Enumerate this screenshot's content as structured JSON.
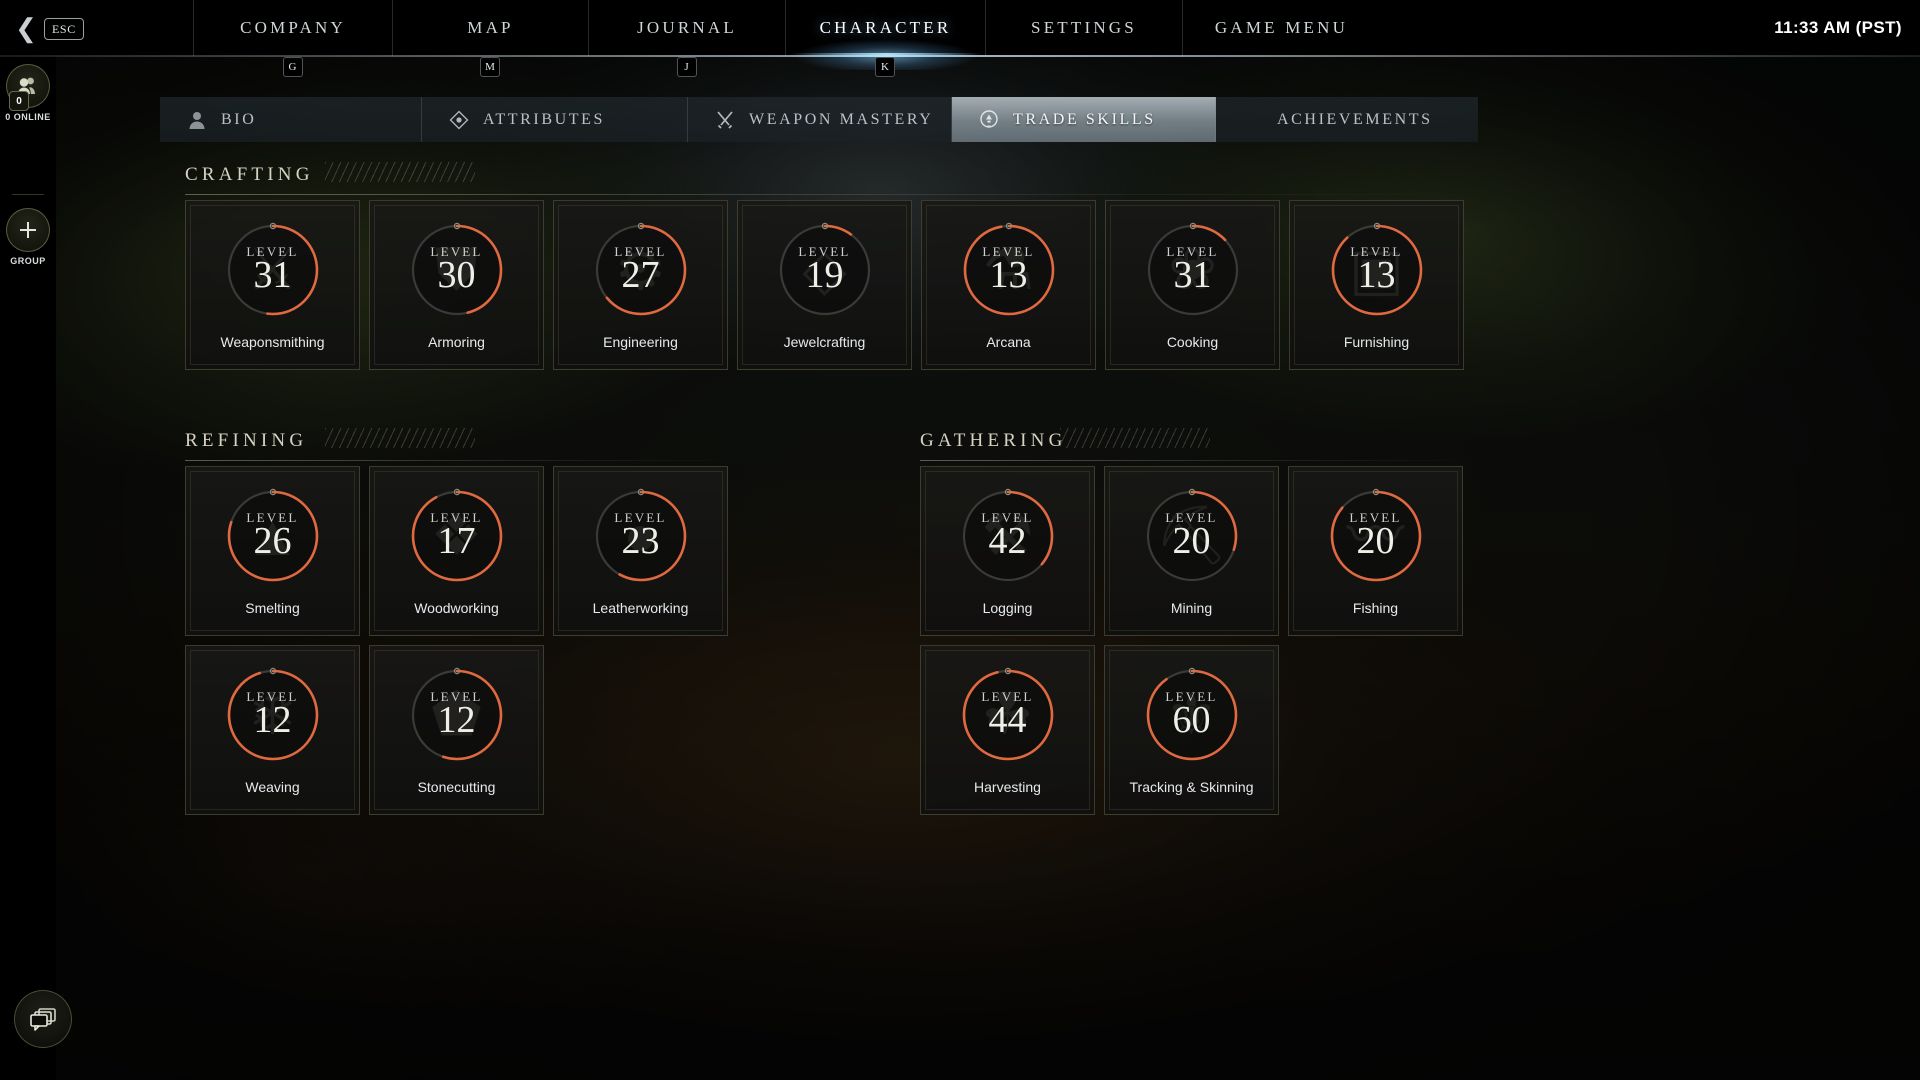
{
  "topbar": {
    "back_icon": "chevron-left-icon",
    "esc_label": "ESC",
    "clock": "11:33 AM  (PST)",
    "items": [
      {
        "label": "COMPANY",
        "key": "G",
        "active": false
      },
      {
        "label": "MAP",
        "key": "M",
        "active": false
      },
      {
        "label": "JOURNAL",
        "key": "J",
        "active": false
      },
      {
        "label": "CHARACTER",
        "key": "K",
        "active": true
      },
      {
        "label": "SETTINGS",
        "key": "",
        "active": false
      },
      {
        "label": "GAME MENU",
        "key": "",
        "active": false
      }
    ]
  },
  "sidebar": {
    "online_count": "0",
    "online_label": "0 ONLINE",
    "group_label": "GROUP",
    "group_icon": "plus-icon",
    "online_icon": "people-icon",
    "chat_icon": "chat-bubbles-icon"
  },
  "tabs": [
    {
      "label": "BIO",
      "icon": "bust-icon",
      "active": false
    },
    {
      "label": "ATTRIBUTES",
      "icon": "diamond-icon",
      "active": false
    },
    {
      "label": "WEAPON MASTERY",
      "icon": "swords-icon",
      "active": false
    },
    {
      "label": "TRADE SKILLS",
      "icon": "anvil-ring-icon",
      "active": true
    },
    {
      "label": "ACHIEVEMENTS",
      "icon": "",
      "active": false
    }
  ],
  "level_word": "LEVEL",
  "accent_color": "#e0693f",
  "track_color": "#3a3a38",
  "sections": [
    {
      "title": "CRAFTING",
      "skills": [
        {
          "name": "Weaponsmithing",
          "level": "31",
          "progress": 0.52,
          "emblem": "⚔"
        },
        {
          "name": "Armoring",
          "level": "30",
          "progress": 0.46,
          "emblem": "⛊"
        },
        {
          "name": "Engineering",
          "level": "27",
          "progress": 0.64,
          "emblem": "⚙"
        },
        {
          "name": "Jewelcrafting",
          "level": "19",
          "progress": 0.1,
          "emblem": "◇"
        },
        {
          "name": "Arcana",
          "level": "13",
          "progress": 0.97,
          "emblem": "⚗"
        },
        {
          "name": "Cooking",
          "level": "31",
          "progress": 0.13,
          "emblem": "❀"
        },
        {
          "name": "Furnishing",
          "level": "13",
          "progress": 0.88,
          "emblem": "▣"
        }
      ]
    },
    {
      "title": "REFINING",
      "skills": [
        {
          "name": "Smelting",
          "level": "26",
          "progress": 0.8,
          "emblem": "▲"
        },
        {
          "name": "Woodworking",
          "level": "17",
          "progress": 0.92,
          "emblem": "❖"
        },
        {
          "name": "Leatherworking",
          "level": "23",
          "progress": 0.58,
          "emblem": "●"
        },
        {
          "name": "Weaving",
          "level": "12",
          "progress": 0.95,
          "emblem": "❄"
        },
        {
          "name": "Stonecutting",
          "level": "12",
          "progress": 0.55,
          "emblem": "⬟"
        }
      ]
    },
    {
      "title": "GATHERING",
      "skills": [
        {
          "name": "Logging",
          "level": "42",
          "progress": 0.36,
          "emblem": "⚒"
        },
        {
          "name": "Mining",
          "level": "20",
          "progress": 0.3,
          "emblem": "⛏"
        },
        {
          "name": "Fishing",
          "level": "20",
          "progress": 0.86,
          "emblem": "〰"
        },
        {
          "name": "Harvesting",
          "level": "44",
          "progress": 0.96,
          "emblem": "☘"
        },
        {
          "name": "Tracking & Skinning",
          "level": "60",
          "progress": 0.9,
          "emblem": "⚜"
        }
      ]
    }
  ]
}
